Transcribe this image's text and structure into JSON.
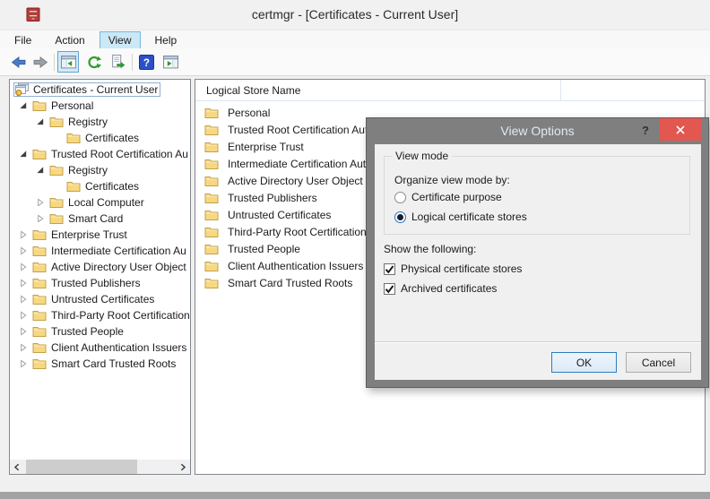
{
  "window": {
    "title": "certmgr - [Certificates - Current User]"
  },
  "menu": {
    "items": [
      {
        "label": "File",
        "active": false
      },
      {
        "label": "Action",
        "active": false
      },
      {
        "label": "View",
        "active": true
      },
      {
        "label": "Help",
        "active": false
      }
    ]
  },
  "toolbar": {
    "help_glyph": "?",
    "icons": [
      "back-arrow",
      "forward-arrow",
      "show-console-tree",
      "refresh",
      "export-list",
      "help",
      "show-action-pane"
    ]
  },
  "tree": {
    "items": [
      {
        "label": "Certificates - Current User",
        "indent": 0,
        "glyph": "none",
        "icon": "certstore",
        "selected": true
      },
      {
        "label": "Personal",
        "indent": 1,
        "glyph": "open",
        "icon": "folder",
        "selected": false
      },
      {
        "label": "Registry",
        "indent": 2,
        "glyph": "open",
        "icon": "folder",
        "selected": false
      },
      {
        "label": "Certificates",
        "indent": 3,
        "glyph": "none",
        "icon": "folder",
        "selected": false
      },
      {
        "label": "Trusted Root Certification Au",
        "indent": 1,
        "glyph": "open",
        "icon": "folder",
        "selected": false
      },
      {
        "label": "Registry",
        "indent": 2,
        "glyph": "open",
        "icon": "folder",
        "selected": false
      },
      {
        "label": "Certificates",
        "indent": 3,
        "glyph": "none",
        "icon": "folder",
        "selected": false
      },
      {
        "label": "Local Computer",
        "indent": 2,
        "glyph": "closed",
        "icon": "folder",
        "selected": false
      },
      {
        "label": "Smart Card",
        "indent": 2,
        "glyph": "closed",
        "icon": "folder",
        "selected": false
      },
      {
        "label": "Enterprise Trust",
        "indent": 1,
        "glyph": "closed",
        "icon": "folder",
        "selected": false
      },
      {
        "label": "Intermediate Certification Au",
        "indent": 1,
        "glyph": "closed",
        "icon": "folder",
        "selected": false
      },
      {
        "label": "Active Directory User Object",
        "indent": 1,
        "glyph": "closed",
        "icon": "folder",
        "selected": false
      },
      {
        "label": "Trusted Publishers",
        "indent": 1,
        "glyph": "closed",
        "icon": "folder",
        "selected": false
      },
      {
        "label": "Untrusted Certificates",
        "indent": 1,
        "glyph": "closed",
        "icon": "folder",
        "selected": false
      },
      {
        "label": "Third-Party Root Certification",
        "indent": 1,
        "glyph": "closed",
        "icon": "folder",
        "selected": false
      },
      {
        "label": "Trusted People",
        "indent": 1,
        "glyph": "closed",
        "icon": "folder",
        "selected": false
      },
      {
        "label": "Client Authentication Issuers",
        "indent": 1,
        "glyph": "closed",
        "icon": "folder",
        "selected": false
      },
      {
        "label": "Smart Card Trusted Roots",
        "indent": 1,
        "glyph": "closed",
        "icon": "folder",
        "selected": false
      }
    ]
  },
  "list": {
    "header": "Logical Store Name",
    "items": [
      "Personal",
      "Trusted Root Certification Aut",
      "Enterprise Trust",
      "Intermediate Certification Autl",
      "Active Directory User Object",
      "Trusted Publishers",
      "Untrusted Certificates",
      "Third-Party Root Certification",
      "Trusted People",
      "Client Authentication Issuers",
      "Smart Card Trusted Roots"
    ]
  },
  "dialog": {
    "title": "View Options",
    "help_label": "?",
    "view_mode_group": {
      "title": "View mode",
      "organize_label": "Organize view mode by:",
      "options": [
        {
          "label": "Certificate purpose",
          "selected": false
        },
        {
          "label": "Logical certificate stores",
          "selected": true
        }
      ]
    },
    "show_section": {
      "label": "Show the following:",
      "options": [
        {
          "label": "Physical certificate stores",
          "checked": true
        },
        {
          "label": "Archived certificates",
          "checked": true
        }
      ]
    },
    "ok_label": "OK",
    "cancel_label": "Cancel"
  },
  "colors": {
    "menu_highlight": "#cbe8f6",
    "dialog_chrome": "#7f7f7f",
    "close_red": "#e25750",
    "default_button_border": "#2e7cbe",
    "folder": "#f7d881",
    "pane_border": "#82878f"
  }
}
